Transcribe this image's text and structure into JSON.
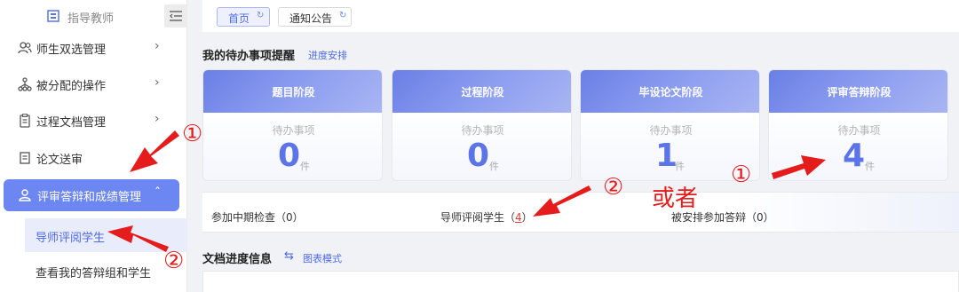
{
  "sidebar": {
    "title": "指导教师",
    "items": [
      {
        "label": "师生双选管理",
        "icon": "users-icon"
      },
      {
        "label": "被分配的操作",
        "icon": "network-icon"
      },
      {
        "label": "过程文档管理",
        "icon": "document-icon"
      },
      {
        "label": "论文送审",
        "icon": "file-icon"
      },
      {
        "label": "评审答辩和成绩管理",
        "icon": "person-icon"
      }
    ],
    "sub_items": [
      "导师评阅学生",
      "查看我的答辩组和学生"
    ]
  },
  "tabs": [
    {
      "label": "首页"
    },
    {
      "label": "通知公告"
    }
  ],
  "todo": {
    "title": "我的待办事项提醒",
    "link": "进度安排",
    "pending_label": "待办事项",
    "unit": "件",
    "cards": [
      {
        "title": "题目阶段",
        "count": "0"
      },
      {
        "title": "过程阶段",
        "count": "0"
      },
      {
        "title": "毕设论文阶段",
        "count": "1"
      },
      {
        "title": "评审答辩阶段",
        "count": "4"
      }
    ]
  },
  "stats": {
    "midterm": "参加中期检查（0）",
    "review_prefix": "导师评阅学生（",
    "review_count": "4",
    "review_suffix": "）",
    "defense": "被安排参加答辩（0）"
  },
  "docs": {
    "title": "文档进度信息",
    "link": "图表模式"
  },
  "annotations": {
    "mark1": "①",
    "mark2": "②",
    "or_text": "或者",
    "color": "#e51c1c"
  },
  "colors": {
    "accent": "#6c86f2",
    "link": "#4f6ae8"
  }
}
